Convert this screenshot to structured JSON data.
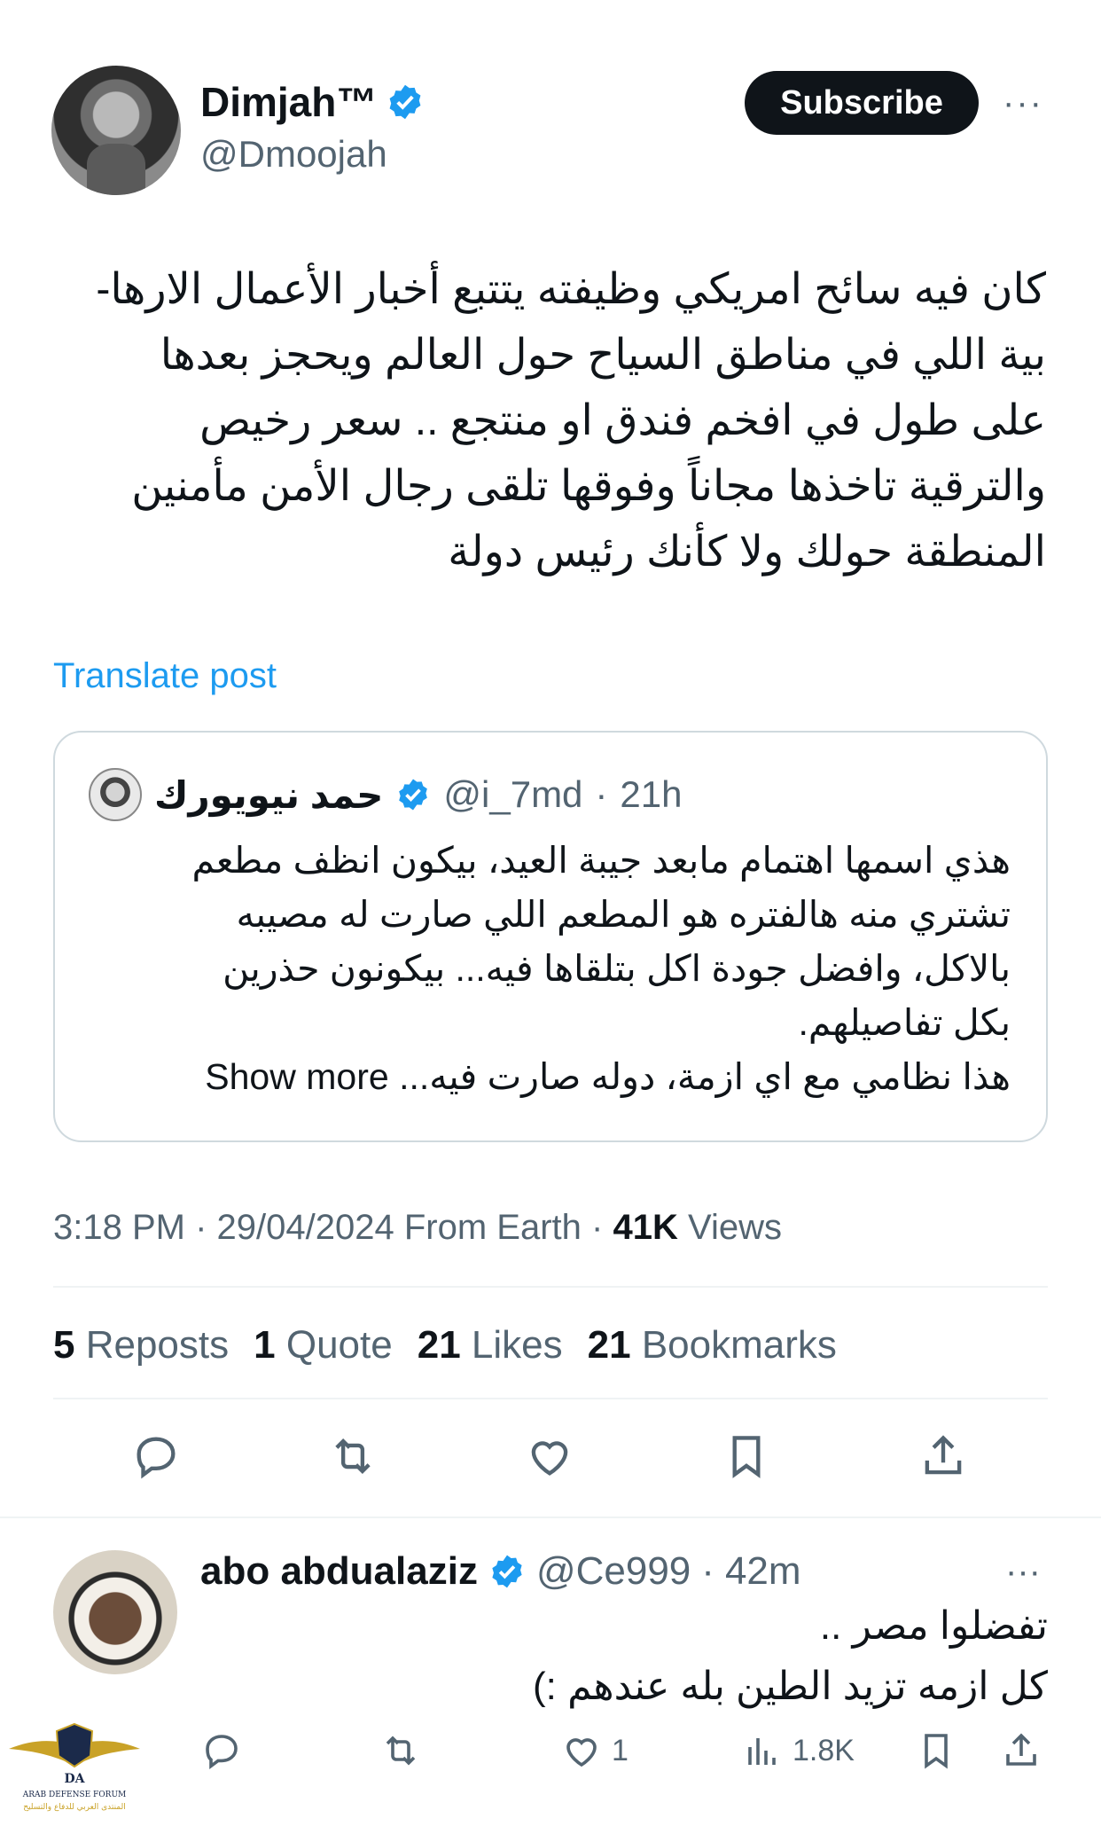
{
  "author": {
    "name": "Dimjah™",
    "handle": "@Dmoojah"
  },
  "header": {
    "subscribe_label": "Subscribe",
    "more_label": "···"
  },
  "post": {
    "lines": [
      "كان فيه سائح امريكي وظيفته يتتبع أخبار الأعمال الارها-",
      "بية اللي في مناطق السياح حول العالم ويحجز بعدها",
      "على طول في افخم فندق او منتجع .. سعر رخيص",
      "والترقية تاخذها مجاناً وفوقها تلقى رجال الأمن مأمنين",
      "المنطقة حولك ولا كأنك رئيس دولة"
    ],
    "translate_label": "Translate post"
  },
  "quote": {
    "name": "حمد نيويورك",
    "handle": "@i_7md",
    "sep": "·",
    "time": "21h",
    "lines": [
      "هذي اسمها اهتمام مابعد جيبة العيد، بيكون انظف مطعم",
      "تشتري منه هالفتره هو المطعم اللي صارت له مصيبه",
      "بالاكل، وافضل جودة اكل بتلقاها فيه... بيكونون حذرين",
      "بكل تفاصيلهم."
    ],
    "last_line": "هذا نظامي مع اي ازمة، دوله صارت فيه...",
    "show_more": "Show more"
  },
  "meta": {
    "time": "3:18 PM",
    "date": "29/04/2024",
    "source": "From Earth",
    "views_count": "41K",
    "views_label": "Views",
    "sep": "·"
  },
  "stats": {
    "reposts_count": "5",
    "reposts_label": "Reposts",
    "quote_count": "1",
    "quote_label": "Quote",
    "likes_count": "21",
    "likes_label": "Likes",
    "bookmarks_count": "21",
    "bookmarks_label": "Bookmarks"
  },
  "reply": {
    "name": "abo abdualaziz",
    "handle": "@Ce999",
    "sep": "·",
    "time": "42m",
    "lines": [
      "تفضلوا مصر ..",
      "كل ازمه تزيد الطين بله عندهم :)"
    ],
    "likes": "1",
    "views": "1.8K",
    "more_label": "···"
  },
  "watermark": {
    "logo_text": "DA",
    "forum_name": "ARAB DEFENSE FORUM",
    "forum_name_ar": "المنتدى العربي للدفاع والتسليح"
  },
  "colors": {
    "accent": "#1d9bf0",
    "text": "#0f1419",
    "secondary": "#536471",
    "border": "#cfd9de"
  }
}
